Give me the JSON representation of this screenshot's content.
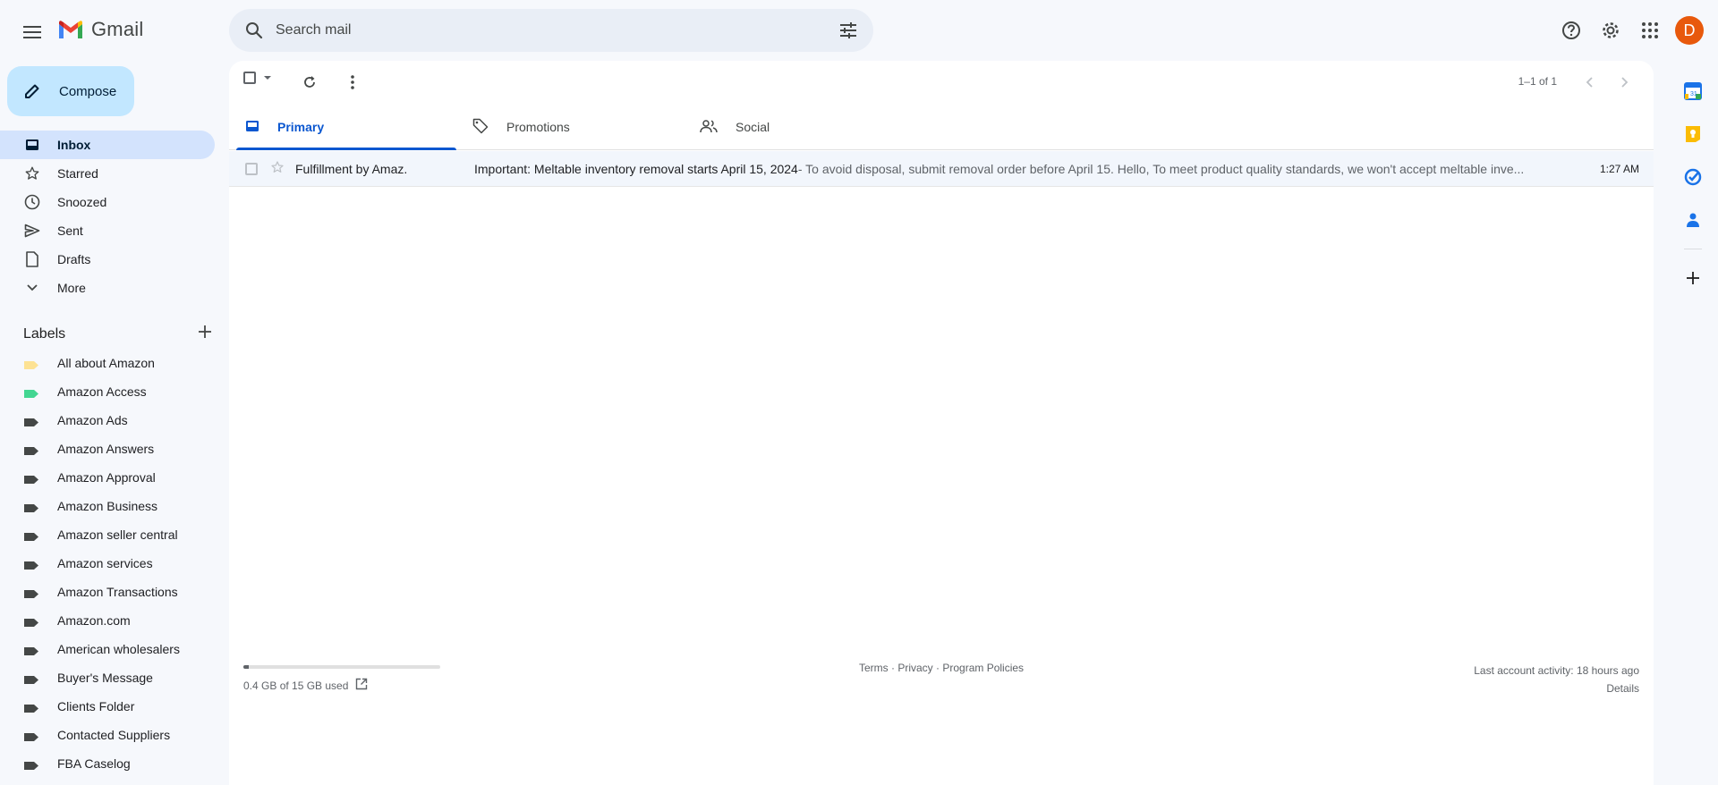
{
  "app": {
    "name": "Gmail"
  },
  "search": {
    "placeholder": "Search mail"
  },
  "account": {
    "initial": "D",
    "color": "#e8590c"
  },
  "compose": {
    "label": "Compose"
  },
  "nav": [
    {
      "label": "Inbox",
      "icon": "inbox-icon",
      "active": true
    },
    {
      "label": "Starred",
      "icon": "star-icon"
    },
    {
      "label": "Snoozed",
      "icon": "clock-icon"
    },
    {
      "label": "Sent",
      "icon": "send-icon"
    },
    {
      "label": "Drafts",
      "icon": "draft-icon"
    },
    {
      "label": "More",
      "icon": "chevron-down-icon"
    }
  ],
  "labels": {
    "title": "Labels",
    "items": [
      {
        "label": "All about Amazon",
        "color": "#fde293"
      },
      {
        "label": "Amazon Access",
        "color": "#43d692"
      },
      {
        "label": "Amazon Ads",
        "color": "#444746"
      },
      {
        "label": "Amazon Answers",
        "color": "#444746"
      },
      {
        "label": "Amazon Approval",
        "color": "#444746"
      },
      {
        "label": "Amazon Business",
        "color": "#444746"
      },
      {
        "label": "Amazon seller central",
        "color": "#444746"
      },
      {
        "label": "Amazon services",
        "color": "#444746"
      },
      {
        "label": "Amazon Transactions",
        "color": "#444746"
      },
      {
        "label": "Amazon.com",
        "color": "#444746"
      },
      {
        "label": "American wholesalers",
        "color": "#444746"
      },
      {
        "label": "Buyer's Message",
        "color": "#444746"
      },
      {
        "label": "Clients Folder",
        "color": "#444746"
      },
      {
        "label": "Contacted Suppliers",
        "color": "#444746"
      },
      {
        "label": "FBA Caselog",
        "color": "#444746"
      }
    ]
  },
  "toolbar": {
    "pager": "1–1 of 1"
  },
  "tabs": [
    {
      "label": "Primary",
      "icon": "inbox-tab-icon",
      "active": true
    },
    {
      "label": "Promotions",
      "icon": "tag-icon"
    },
    {
      "label": "Social",
      "icon": "people-icon"
    }
  ],
  "emails": [
    {
      "sender": "Fulfillment by Amaz.",
      "subject": "Important: Meltable inventory removal starts April 15, 2024",
      "snippet": " - To avoid disposal, submit removal order before April 15. Hello, To meet product quality standards, we won't accept meltable inve...",
      "time": "1:27 AM"
    }
  ],
  "footer": {
    "storage": "0.4 GB of 15 GB used",
    "storage_fraction": 0.027,
    "terms": "Terms",
    "privacy": "Privacy",
    "policies": "Program Policies",
    "sep": " · ",
    "activity": "Last account activity: 18 hours ago",
    "details": "Details"
  }
}
